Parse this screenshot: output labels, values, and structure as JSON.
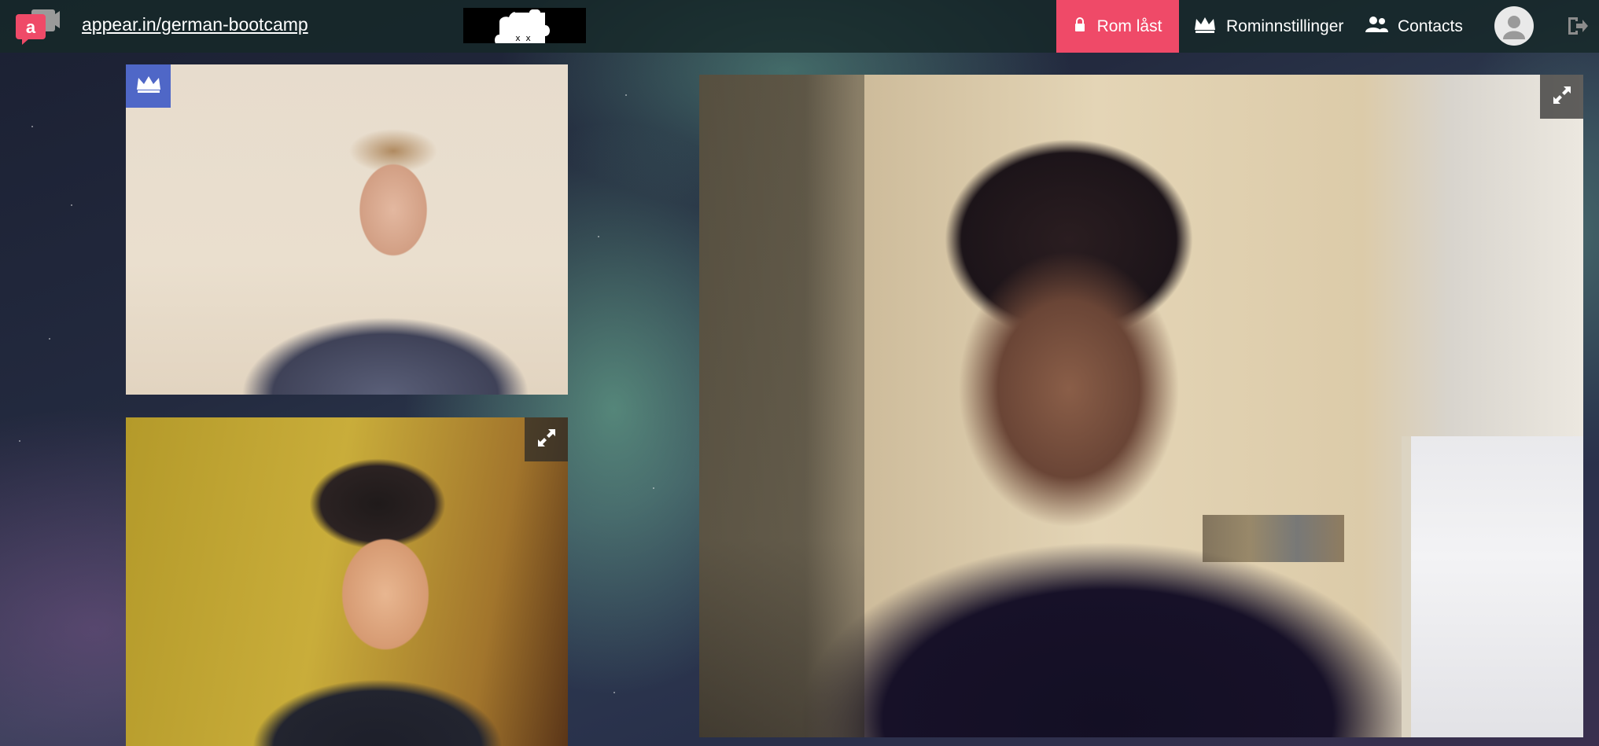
{
  "header": {
    "room_url": "appear.in/german-bootcamp",
    "lock_button_label": "Rom låst",
    "room_settings_label": "Rominnstillinger",
    "contacts_label": "Contacts"
  },
  "colors": {
    "lock_accent": "#ef4a68",
    "owner_badge": "#4f67c7",
    "topbar": "#162828",
    "logo": "#ef4a68"
  },
  "icons": {
    "logo": "appear-in-logo-icon",
    "puzzle": "puzzle-piece-face-icon",
    "lock": "lock-icon",
    "crown": "crown-icon",
    "contacts": "contacts-icon",
    "avatar": "user-avatar-icon",
    "logout": "logout-icon",
    "expand": "expand-icon"
  }
}
